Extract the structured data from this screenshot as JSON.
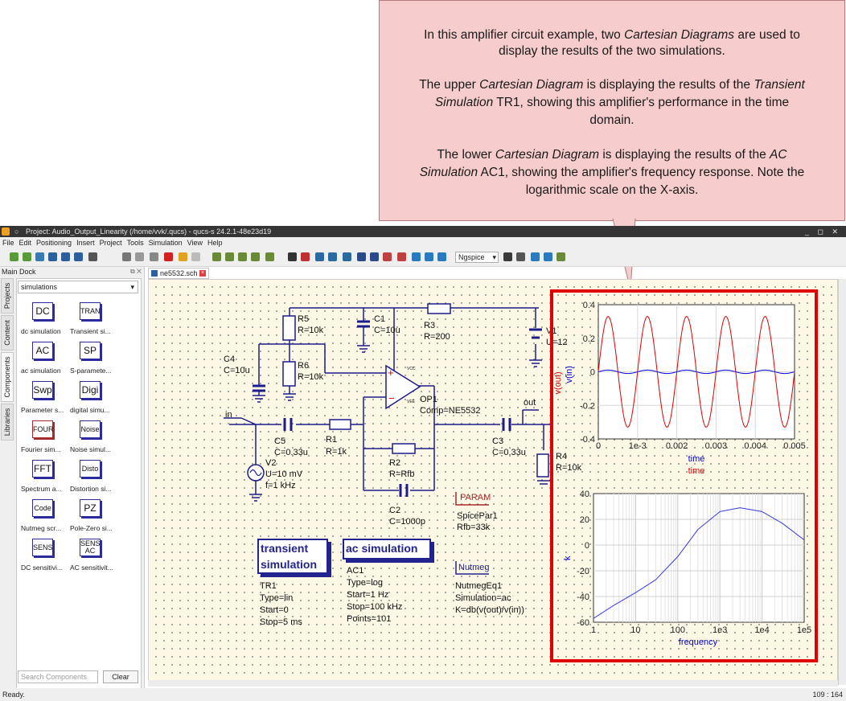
{
  "callout": {
    "p1_a": "In this amplifier circuit example, two ",
    "p1_em": "Cartesian Diagrams",
    "p1_b": " are used to",
    "p1_c": "display the results of the two simulations.",
    "p2_a": "The upper ",
    "p2_em1": "Cartesian Diagram",
    "p2_b": " is displaying the results of the ",
    "p2_em2": "Transient",
    "p2_em3": "Simulation",
    "p2_c": " TR1, showing this amplifier's performance in the time",
    "p2_d": "domain.",
    "p3_a": "The lower ",
    "p3_em1": "Cartesian Diagram",
    "p3_b": " is displaying the results of the ",
    "p3_em2": "AC",
    "p3_em3": "Simulation",
    "p3_c": " AC1, showing the amplifier's frequency response. Note the",
    "p3_d": "logarithmic scale on the X-axis."
  },
  "window": {
    "title": "Project: Audio_Output_Linearity (/home/vvk/.qucs) - qucs-s 24.2.1-48e23d19",
    "controls": "_ ◻ ✕"
  },
  "menu": [
    "File",
    "Edit",
    "Positioning",
    "Insert",
    "Project",
    "Tools",
    "Simulation",
    "View",
    "Help"
  ],
  "toolbar": {
    "simulator": "Ngspice"
  },
  "dock": {
    "title": "Main Dock",
    "tabs": [
      "Projects",
      "Content",
      "Components",
      "Libraries"
    ],
    "category": "simulations",
    "components": [
      {
        "icon": "DC",
        "label": "dc simulation"
      },
      {
        "icon": "TRAN",
        "label": "Transient si..."
      },
      {
        "icon": "AC",
        "label": "ac simulation"
      },
      {
        "icon": "SP",
        "label": "S-paramete..."
      },
      {
        "icon": "Swp",
        "label": "Parameter s..."
      },
      {
        "icon": "Digi",
        "label": "digital simu..."
      },
      {
        "icon": "FOUR",
        "label": "Fourier sim..."
      },
      {
        "icon": "Noise",
        "label": "Noise simul..."
      },
      {
        "icon": "FFT",
        "label": "Spectrum a..."
      },
      {
        "icon": "Disto",
        "label": "Distortion si..."
      },
      {
        "icon": "Code",
        "label": "Nutmeg scr..."
      },
      {
        "icon": "PZ",
        "label": "Pole-Zero si..."
      },
      {
        "icon": "SENS",
        "label": "DC sensitivi..."
      },
      {
        "icon": "SENS AC",
        "label": "AC sensitivit..."
      }
    ],
    "search_placeholder": "Search Components",
    "clear": "Clear"
  },
  "document": {
    "tab": "ne5532.sch"
  },
  "schematic": {
    "r5_name": "R5",
    "r5_val": "R=10k",
    "r6_name": "R6",
    "r6_val": "R=10k",
    "c1_name": "C1",
    "c1_val": "C=10u",
    "r3_name": "R3",
    "r3_val": "R=200",
    "v1_name": "V1",
    "v1_val": "U=12",
    "c4_name": "C4",
    "c4_val": "C=10u",
    "op1_name": "OP1",
    "op1_val": "Comp=NE5532",
    "vcc": "VCC",
    "vee": "VEE",
    "in_label": "in",
    "out_label": "out",
    "c5_name": "C5",
    "c5_val": "C=0.33u",
    "r1_name": "R1",
    "r1_val": "R=1k",
    "c3_name": "C3",
    "c3_val": "C=0.33u",
    "r4_name": "R4",
    "r4_val": "R=10k",
    "v2_name": "V2",
    "v2_u": "U=10 mV",
    "v2_f": "f=1 kHz",
    "r2_name": "R2",
    "r2_val": "R=Rfb",
    "c2_name": "C2",
    "c2_val": "C=1000p",
    "param_title": "PARAM",
    "param_name": "SpicePar1",
    "param_val": "Rfb=33k",
    "tr_box_1": "transient",
    "tr_box_2": "simulation",
    "tr_name": "TR1",
    "tr_type": "Type=lin",
    "tr_start": "Start=0",
    "tr_stop": "Stop=5 ms",
    "ac_box": "ac simulation",
    "ac_name": "AC1",
    "ac_type": "Type=log",
    "ac_start": "Start=1 Hz",
    "ac_stop": "Stop=100 kHz",
    "ac_points": "Points=101",
    "nut_title": "Nutmeg",
    "nut_name": "NutmegEq1",
    "nut_sim": "Simulation=ac",
    "nut_eq": "K=db(v(out)/v(in))"
  },
  "chart_data": [
    {
      "type": "line",
      "x_label": "time",
      "y_labels": [
        "v(out)",
        "v(in)"
      ],
      "xlim": [
        0,
        0.005
      ],
      "ylim": [
        -0.4,
        0.4
      ],
      "x_ticks": [
        "0",
        "1e-3",
        "0.002",
        "0.003",
        "0.004",
        "0.005"
      ],
      "y_ticks": [
        "0.4",
        "0.2",
        "0",
        "-0.2",
        "-0.4"
      ],
      "legend": [
        "time",
        "time"
      ],
      "series": [
        {
          "name": "v(out)",
          "color": "#e00000",
          "amplitude": 0.33,
          "frequency_hz": 1000
        },
        {
          "name": "v(in)",
          "color": "#0000e0",
          "amplitude": 0.01,
          "frequency_hz": 1000
        }
      ]
    },
    {
      "type": "line",
      "x_label": "frequency",
      "y_label": "k",
      "x_scale": "log",
      "xlim": [
        1,
        100000
      ],
      "ylim": [
        -60,
        40
      ],
      "x_ticks": [
        "1",
        "10",
        "100",
        "1e3",
        "1e4",
        "1e5"
      ],
      "y_ticks": [
        "40",
        "20",
        "0",
        "-20",
        "-40",
        "-60"
      ],
      "series": [
        {
          "name": "k",
          "color": "#3a3ae0",
          "x": [
            1,
            3,
            10,
            30,
            100,
            300,
            1000,
            3000,
            10000,
            30000,
            100000
          ],
          "y": [
            -57,
            -47,
            -37,
            -27,
            -9,
            12,
            26,
            29,
            26,
            17,
            4
          ]
        }
      ]
    }
  ],
  "status": {
    "left": "Ready.",
    "right": "109 : 164"
  },
  "colors": {
    "highlight": "#e10000",
    "callout_bg": "#f6cccc",
    "wire": "#1c1c8a",
    "canvas": "#fdf8e6"
  }
}
